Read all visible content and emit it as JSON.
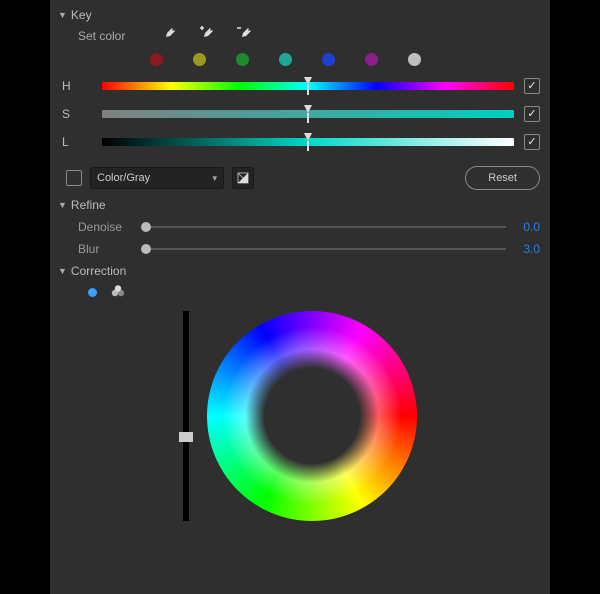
{
  "sections": {
    "key": {
      "title": "Key",
      "set_color_label": "Set color"
    },
    "refine": {
      "title": "Refine"
    },
    "correction": {
      "title": "Correction"
    }
  },
  "swatches": [
    {
      "name": "red",
      "color": "#8b1a1a"
    },
    {
      "name": "yellow",
      "color": "#9a9a1e"
    },
    {
      "name": "green",
      "color": "#1e8b2e"
    },
    {
      "name": "cyan",
      "color": "#1ea89a"
    },
    {
      "name": "blue",
      "color": "#1e3fd0"
    },
    {
      "name": "magenta",
      "color": "#8b1e8b"
    },
    {
      "name": "white",
      "color": "#bfbfbf"
    }
  ],
  "hsl": {
    "h": {
      "label": "H",
      "position_pct": 50,
      "checked": true
    },
    "s": {
      "label": "S",
      "position_pct": 50,
      "checked": true
    },
    "l": {
      "label": "L",
      "position_pct": 50,
      "checked": true
    }
  },
  "color_mode": {
    "checkbox_checked": false,
    "dropdown_label": "Color/Gray"
  },
  "reset_label": "Reset",
  "refine": {
    "denoise": {
      "label": "Denoise",
      "value": "0.0",
      "position_pct": 0
    },
    "blur": {
      "label": "Blur",
      "value": "3.0",
      "position_pct": 0
    }
  },
  "correction": {
    "luminance_thumb_pct": 60
  }
}
